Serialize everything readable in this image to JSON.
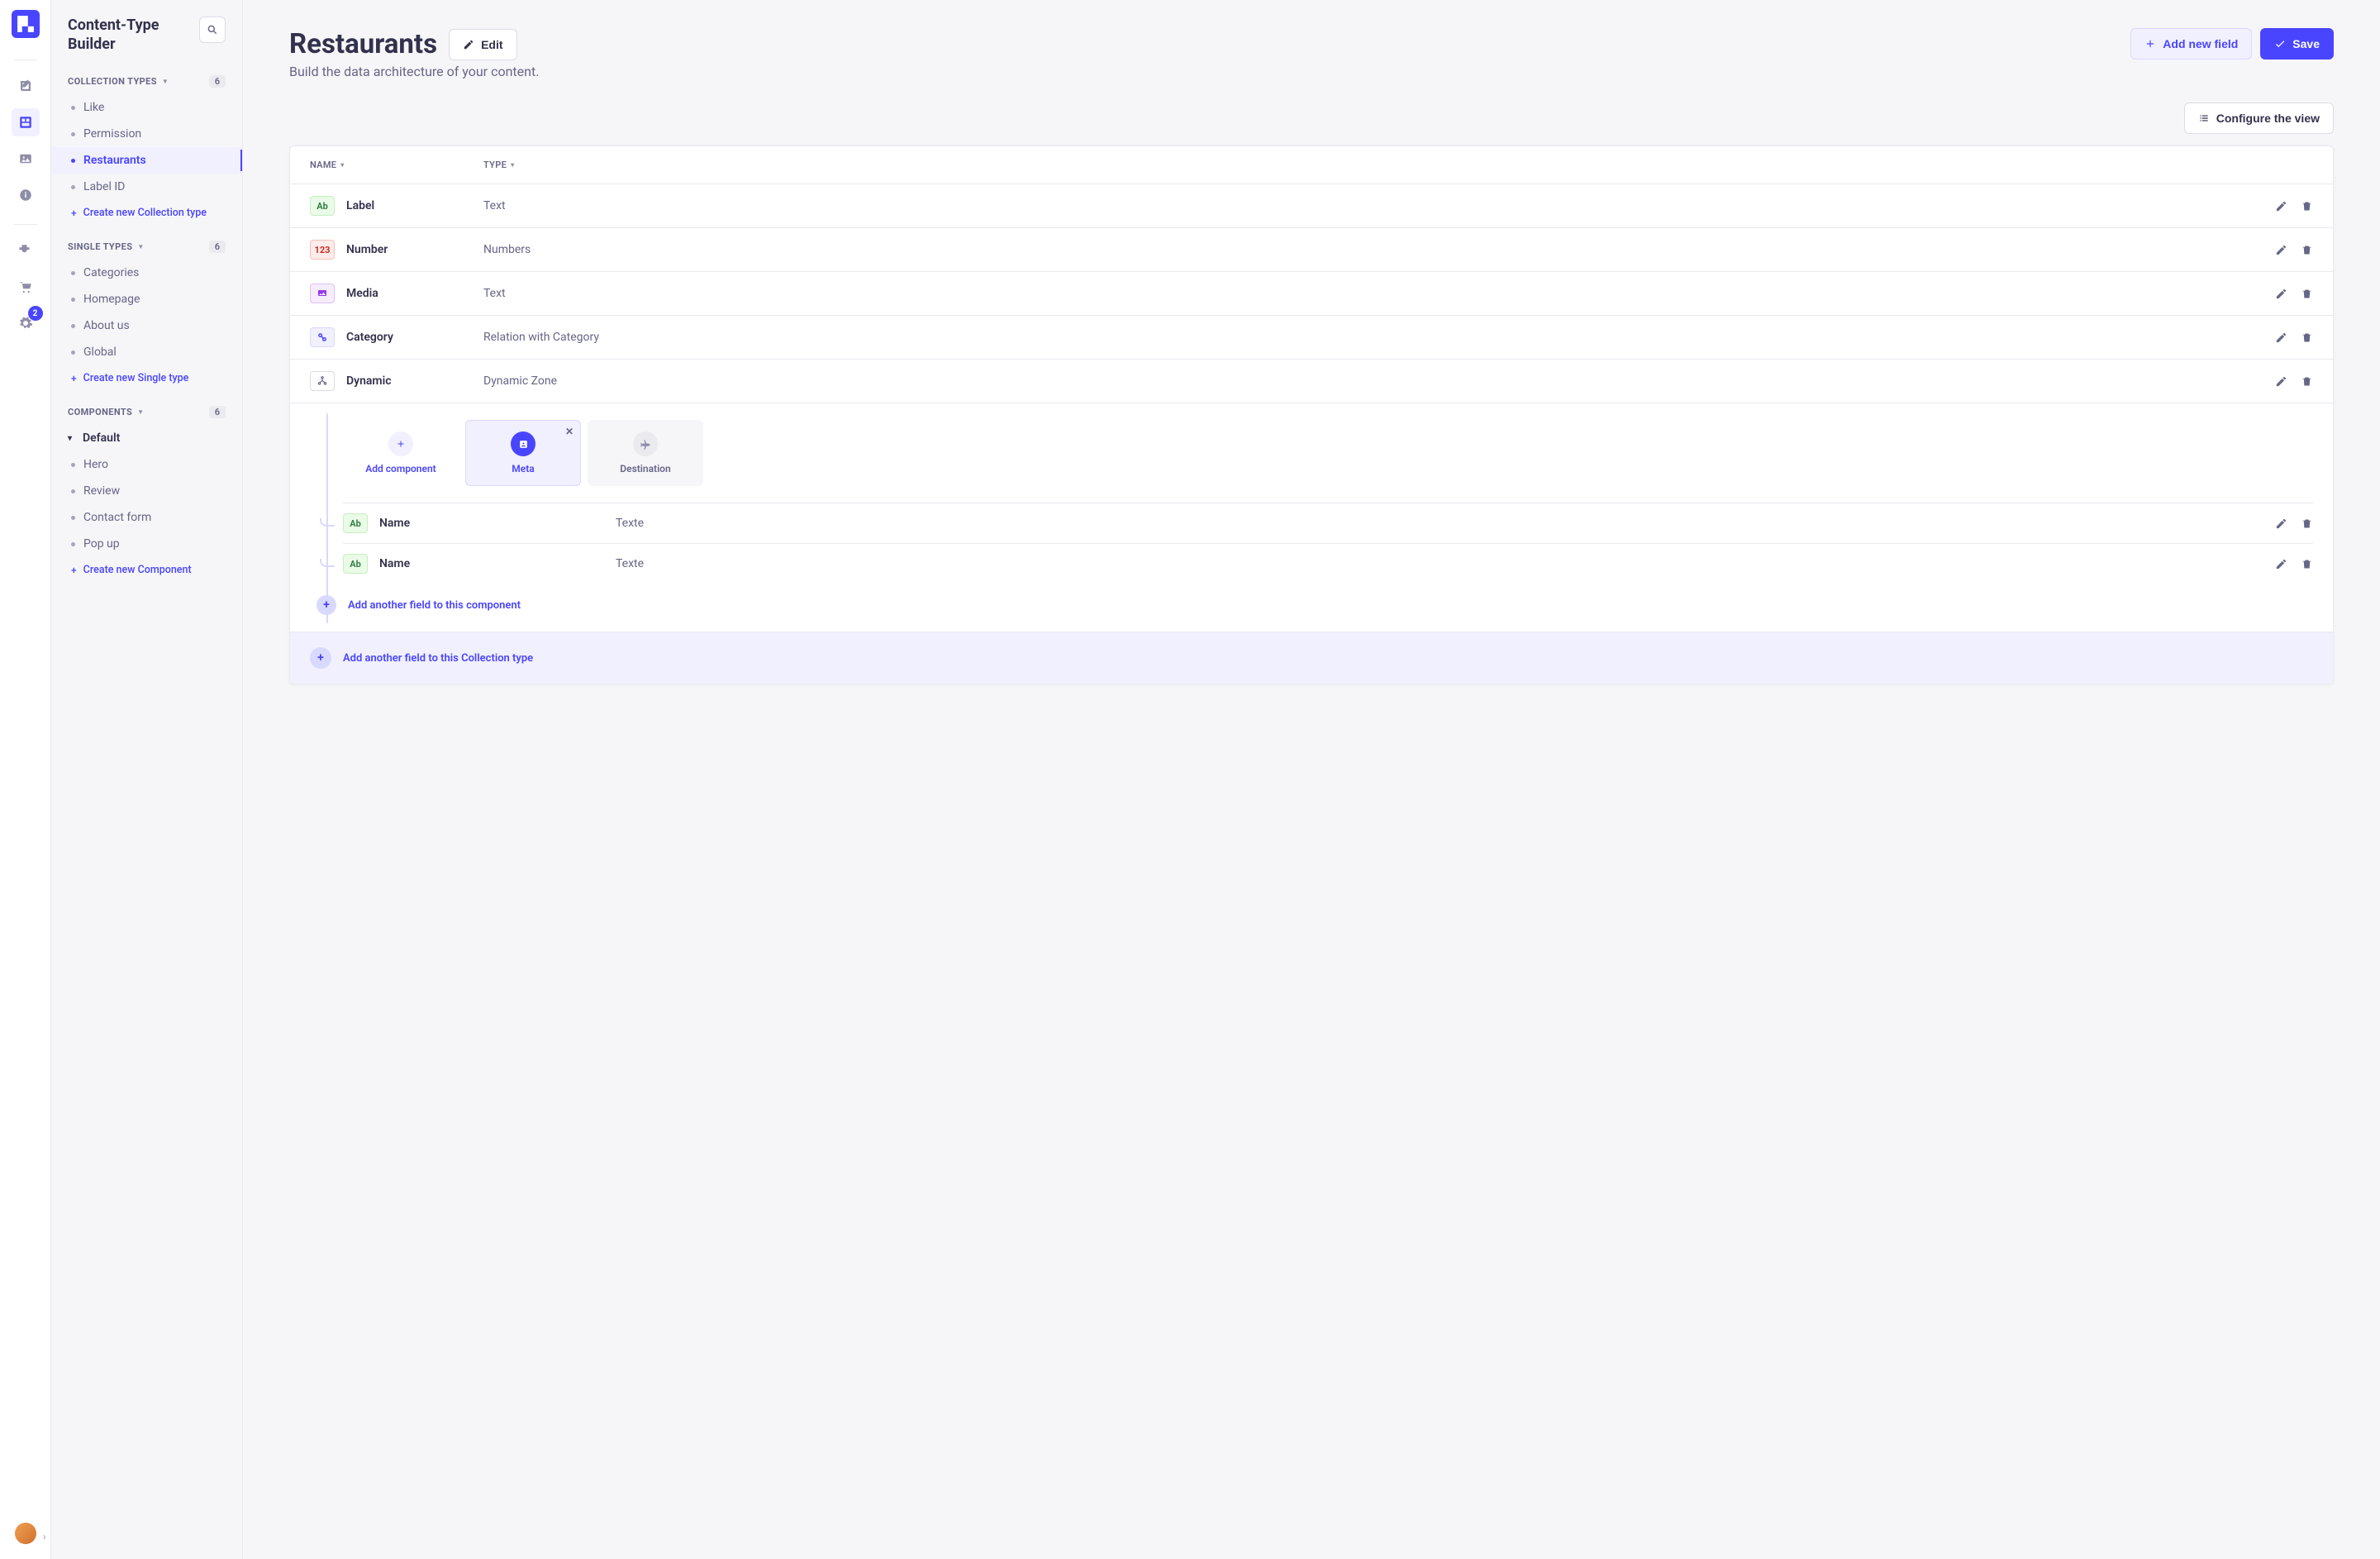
{
  "rail": {
    "settings_badge": "2"
  },
  "sidebar": {
    "title": "Content-Type Builder",
    "sections": {
      "collection": {
        "label": "COLLECTION TYPES",
        "count": "6",
        "items": [
          "Like",
          "Permission",
          "Restaurants",
          "Label ID"
        ],
        "active_index": 2,
        "create": "Create new Collection type"
      },
      "single": {
        "label": "SINGLE TYPES",
        "count": "6",
        "items": [
          "Categories",
          "Homepage",
          "About us",
          "Global"
        ],
        "create": "Create new Single type"
      },
      "components": {
        "label": "COMPONENTS",
        "count": "6",
        "group": "Default",
        "items": [
          "Hero",
          "Review",
          "Contact form",
          "Pop up"
        ],
        "create": "Create new Component"
      }
    }
  },
  "page": {
    "title": "Restaurants",
    "subtitle": "Build the data architecture of your content.",
    "edit": "Edit",
    "add_field": "Add new field",
    "save": "Save",
    "configure": "Configure the view"
  },
  "table": {
    "col_name": "NAME",
    "col_type": "TYPE",
    "rows": [
      {
        "name": "Label",
        "type": "Text",
        "icon": "text"
      },
      {
        "name": "Number",
        "type": "Numbers",
        "icon": "num"
      },
      {
        "name": "Media",
        "type": "Text",
        "icon": "media"
      },
      {
        "name": "Category",
        "type": "Relation with Category",
        "icon": "rel"
      },
      {
        "name": "Dynamic",
        "type": "Dynamic Zone",
        "icon": "dyn"
      }
    ]
  },
  "dyn": {
    "add_component": "Add component",
    "tab_meta": "Meta",
    "tab_destination": "Destination",
    "sub_rows": [
      {
        "name": "Name",
        "type": "Texte"
      },
      {
        "name": "Name",
        "type": "Texte"
      }
    ],
    "add_inner": "Add another field to this component"
  },
  "footer": {
    "add": "Add another field to this Collection type"
  }
}
